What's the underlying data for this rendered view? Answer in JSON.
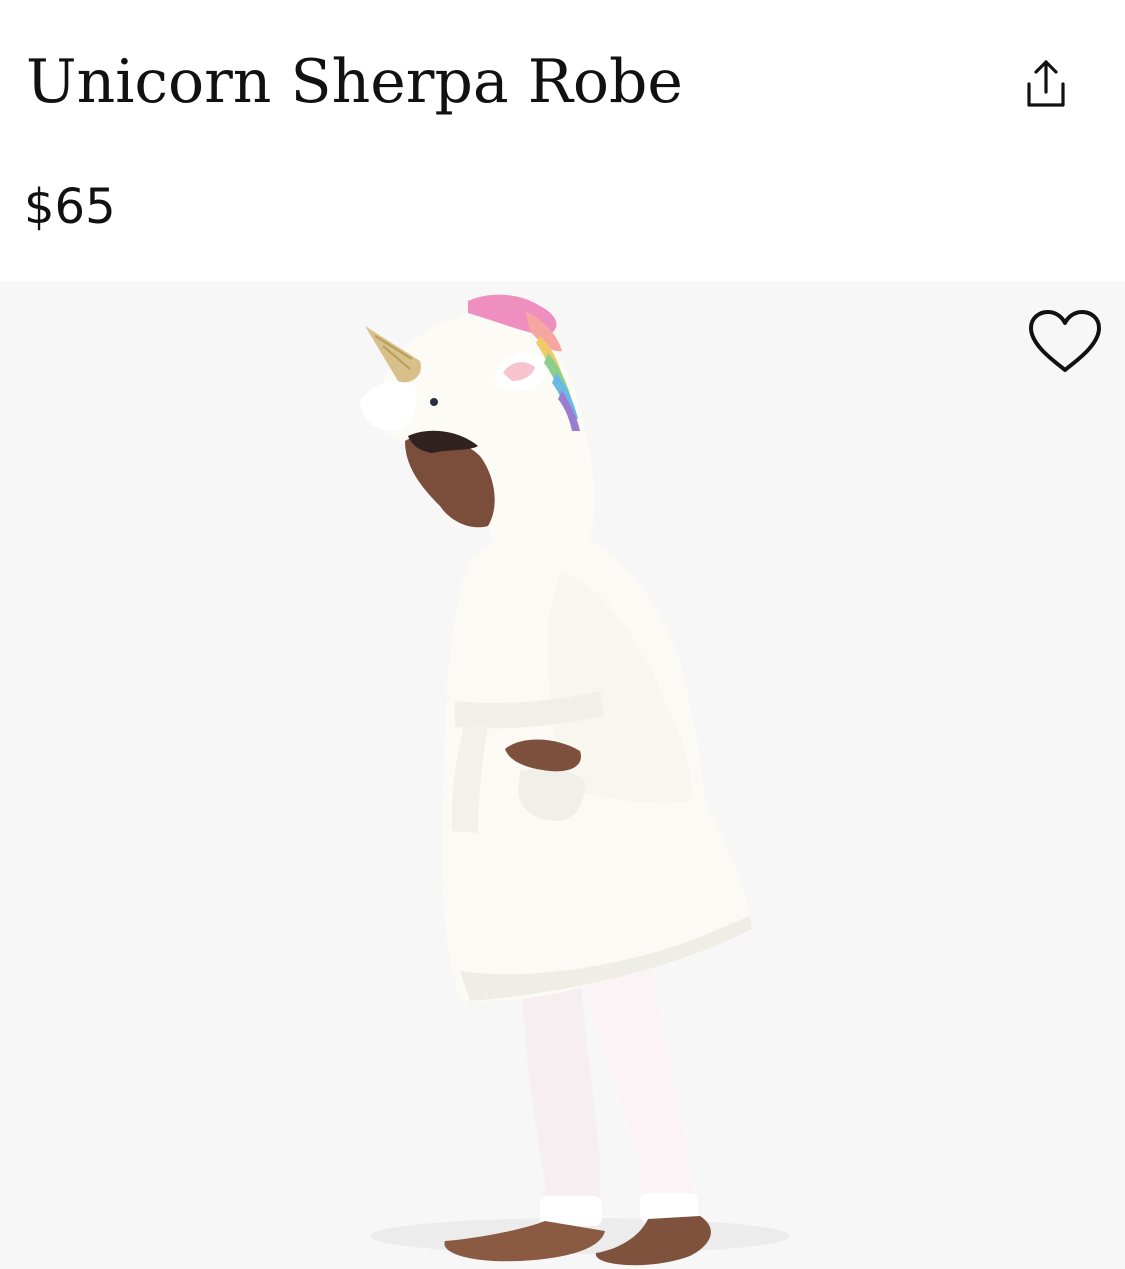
{
  "product": {
    "title": "Unicorn Sherpa Robe",
    "price": "$65"
  },
  "actions": {
    "share_icon": "share-icon",
    "favorite_icon": "heart-outline-icon"
  },
  "image": {
    "background": "#f7f7f7"
  },
  "colors": {
    "text": "#111111",
    "robe": "#fbfaf4",
    "horn": "#d8c08a"
  }
}
